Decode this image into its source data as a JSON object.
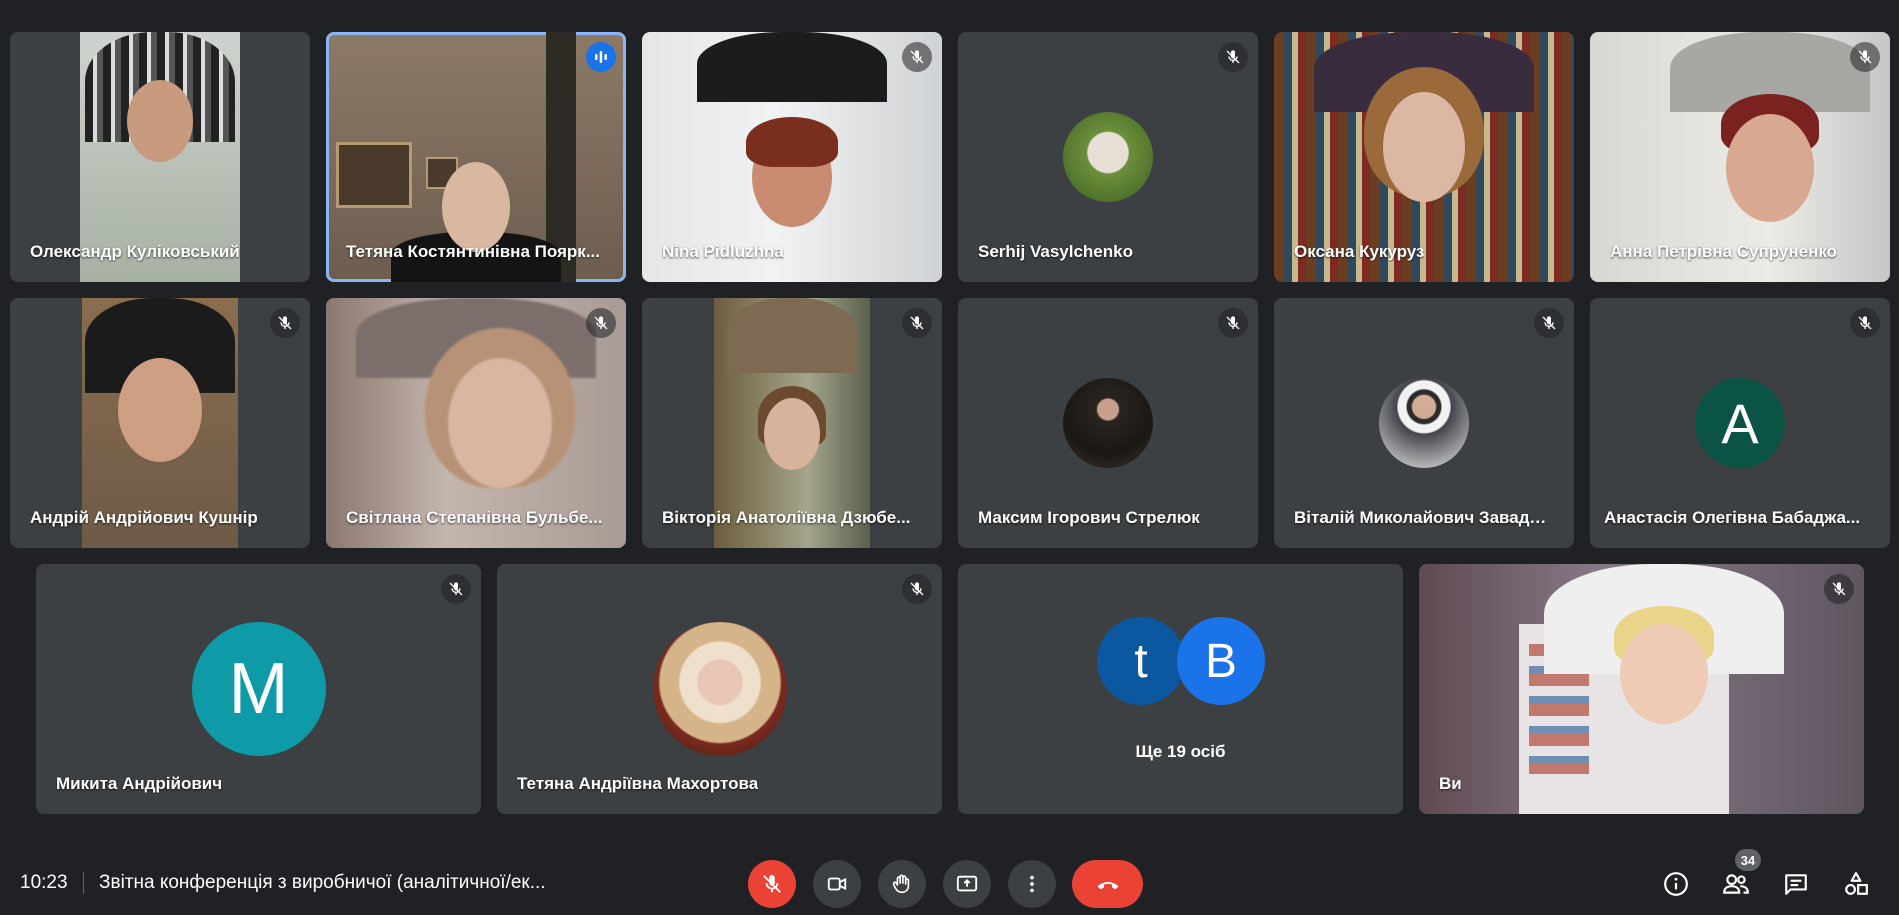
{
  "meeting": {
    "time": "10:23",
    "title": "Звітна конференція з виробничої (аналітичної/ек...",
    "participant_count": "34"
  },
  "participants": [
    {
      "name": "Олександр Куліковський",
      "muted": false
    },
    {
      "name": "Тетяна Костянтинівна Поярк...",
      "speaking": true
    },
    {
      "name": "Nina Pidluzhna",
      "muted": true
    },
    {
      "name": "Serhij Vasylchenko",
      "muted": true
    },
    {
      "name": "Оксана Кукуруз",
      "muted": false
    },
    {
      "name": "Анна Петрівна Супруненко",
      "muted": true
    },
    {
      "name": "Андрій Андрійович Кушнір",
      "muted": true
    },
    {
      "name": "Світлана Степанівна Бульбе...",
      "muted": true
    },
    {
      "name": "Вікторія Анатоліївна Дзюбе...",
      "muted": true
    },
    {
      "name": "Максим Ігорович Стрелюк",
      "muted": true
    },
    {
      "name": "Віталій Миколайович Завадсь...",
      "muted": true
    },
    {
      "name": "Анастасія Олегівна Бабаджа...",
      "muted": true,
      "avatar_letter": "A",
      "avatar_color": "#0b5345"
    },
    {
      "name": "Микита Андрійович",
      "muted": true,
      "avatar_letter": "M",
      "avatar_color": "#0e9aa7"
    },
    {
      "name": "Тетяна Андріївна Махортова",
      "muted": true
    },
    {
      "name": "Ви",
      "muted": true
    }
  ],
  "others": {
    "label": "Ще 19 осіб",
    "avatars": [
      {
        "letter": "t",
        "color": "#0b57a0"
      },
      {
        "letter": "B",
        "color": "#1a73e8"
      }
    ]
  },
  "colors": {
    "background": "#202124",
    "tile": "#3c4043",
    "accent": "#1a73e8",
    "danger": "#ea4335",
    "speaking_border": "#8ab4f8"
  }
}
